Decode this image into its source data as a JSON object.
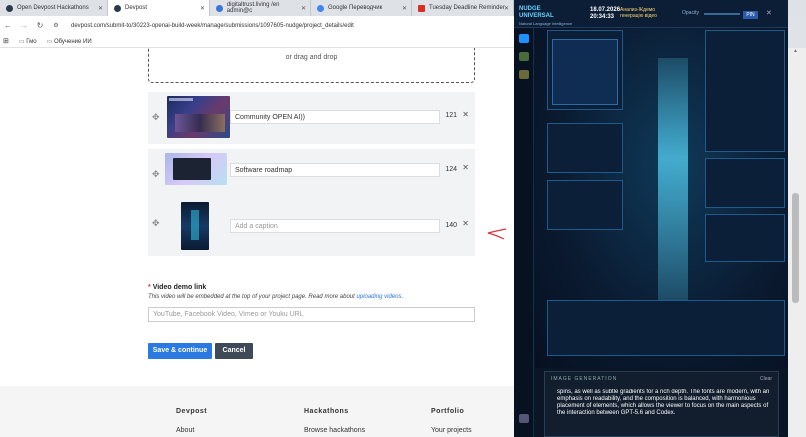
{
  "browser": {
    "tabs": [
      {
        "label": "Open Devpost Hackathons",
        "fav": "#2b3a4a",
        "active": false
      },
      {
        "label": "Devpost",
        "fav": "#2b3a4a",
        "active": true
      },
      {
        "label": "digitaltrust.living /en admin@c",
        "fav": "#3b76d8",
        "active": false
      },
      {
        "label": "Google Переводчик",
        "fav": "#4285f4",
        "active": false
      },
      {
        "label": "Tuesday Deadline Reminder",
        "fav": "#d93025",
        "active": false
      }
    ],
    "url": "devpost.com/submit-to/30223-openai-build-week/manage/submissions/1097605-nudge/project_details/edit",
    "bookmarks": [
      "Гмо",
      "Обучение ИИ"
    ]
  },
  "upload": {
    "label": "or drag and drop"
  },
  "gallery": [
    {
      "caption": "Community OPEN AI))",
      "count": "121",
      "placeholder": ""
    },
    {
      "caption": "Software roadmap",
      "count": "124",
      "placeholder": ""
    },
    {
      "caption": "",
      "count": "140",
      "placeholder": "Add a caption"
    }
  ],
  "demo": {
    "heading": "Video demo link",
    "required_mark": "*",
    "help_text": "This video will be embedded at the top of your project page. Read more about",
    "help_link": "uploading videos",
    "help_end": ".",
    "placeholder": "YouTube, Facebook Video, Vimeo or Youku URL"
  },
  "actions": {
    "save": "Save & continue",
    "cancel": "Cancel"
  },
  "footer": {
    "columns": [
      {
        "heading": "Devpost",
        "link": "About"
      },
      {
        "heading": "Hackathons",
        "link": "Browse hackathons"
      },
      {
        "heading": "Portfolio",
        "link": "Your projects"
      }
    ]
  },
  "overlay": {
    "brand": "NUDGE",
    "brand2": "UNIVERSAL",
    "brand_sub": "Natural Language Intelligence",
    "date": "18.07.2026",
    "time": "20:34:33",
    "ru_line1": "Анализ-Ждемо",
    "ru_line2": "генерацію відео",
    "opacity_label": "Opacity",
    "pin": "PIN",
    "image_generation": "IMAGE GENERATION",
    "clear": "Clear",
    "generated_text": "spins, as well as subtle gradients for a rich depth. The fonts are modern, with an emphasis on readability, and the composition is balanced, with harmonious placement of elements, which allows the viewer to focus on the main aspects of the interaction between GPT-5.6 and Codex."
  }
}
